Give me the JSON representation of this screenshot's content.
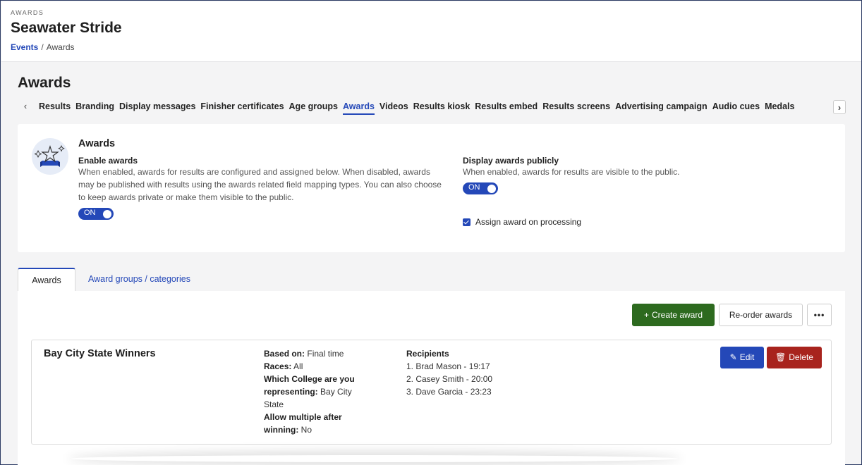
{
  "header": {
    "eyebrow": "AWARDS",
    "event_title": "Seawater Stride",
    "breadcrumb": {
      "link": "Events",
      "separator": "/",
      "current": "Awards"
    }
  },
  "section_heading": "Awards",
  "tabs": {
    "items": [
      "Results",
      "Branding",
      "Display messages",
      "Finisher certificates",
      "Age groups",
      "Awards",
      "Videos",
      "Results kiosk",
      "Results embed",
      "Results screens",
      "Advertising campaign",
      "Audio cues",
      "Medals"
    ],
    "active": "Awards",
    "prev_icon": "chevron-left-icon",
    "next_icon": "chevron-right-icon"
  },
  "settings": {
    "title": "Awards",
    "icon": "trophy-stars-icon",
    "enable": {
      "label": "Enable awards",
      "description": "When enabled, awards for results are configured and assigned below. When disabled, awards may be published with results using the awards related field mapping types. You can also choose to keep awards private or make them visible to the public.",
      "toggle": "ON"
    },
    "display_publicly": {
      "label": "Display awards publicly",
      "description": "When enabled, awards for results are visible to the public.",
      "toggle": "ON"
    },
    "assign_on_processing": {
      "label": "Assign award on processing",
      "checked": true
    }
  },
  "lower_tabs": {
    "active": "Awards",
    "other": "Award groups / categories"
  },
  "toolbar": {
    "create": "Create award",
    "reorder": "Re-order awards",
    "more": "•••"
  },
  "awards": [
    {
      "name": "Bay City State Winners",
      "meta": [
        {
          "key": "Based on:",
          "value": "Final time"
        },
        {
          "key": "Races:",
          "value": "All"
        },
        {
          "key": "Which College are you representing:",
          "value": "Bay City State"
        },
        {
          "key": "Allow multiple after winning:",
          "value": "No"
        }
      ],
      "recipients_label": "Recipients",
      "recipients": [
        "1. Brad Mason - 19:17",
        "2. Casey Smith - 20:00",
        "3. Dave Garcia - 23:23"
      ],
      "edit": "Edit",
      "delete": "Delete"
    }
  ],
  "colors": {
    "primary": "#2448b8",
    "success": "#2d6a1f",
    "danger": "#a8231d"
  }
}
